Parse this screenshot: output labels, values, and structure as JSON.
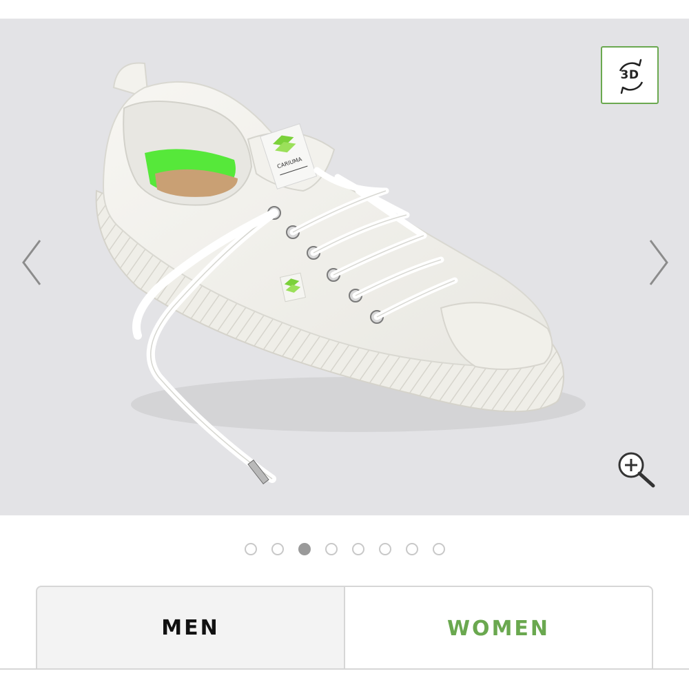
{
  "gallery": {
    "image_alt": "",
    "badge_3d_label": "3D",
    "shoe_brand_label": "CARIUMA",
    "prev_icon": "chevron-left-icon",
    "next_icon": "chevron-right-icon",
    "zoom_icon": "zoom-in-icon",
    "rotate_icon": "rotate-3d-icon"
  },
  "pagination": {
    "count": 8,
    "active_index": 2
  },
  "gender_tabs": [
    {
      "label": "MEN",
      "selected": false
    },
    {
      "label": "WOMEN",
      "selected": true
    }
  ],
  "colors": {
    "accent_green": "#6aa84f",
    "background_gray": "#e3e3e6",
    "dot_active": "#9a9a9a"
  }
}
